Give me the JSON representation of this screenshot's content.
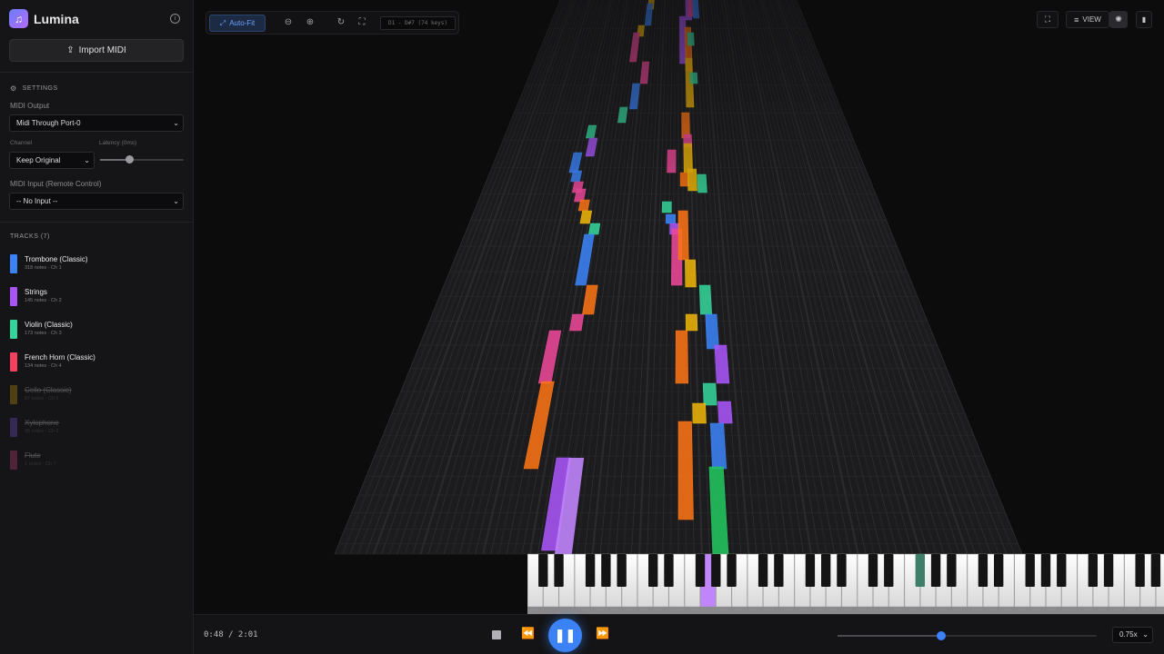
{
  "app": {
    "name": "Lumina",
    "import_label": "Import MIDI"
  },
  "settings": {
    "heading": "SETTINGS",
    "midi_output_label": "MIDI Output",
    "midi_output_value": "Midi Through Port-0",
    "channel_label": "Channel",
    "channel_value": "Keep Original",
    "latency_label": "Latency (0ms)",
    "latency_fraction": 0.35,
    "midi_input_label": "MIDI Input (Remote Control)",
    "midi_input_value": "-- No Input --"
  },
  "tracks": {
    "heading": "TRACKS (7)",
    "items": [
      {
        "name": "Trombone (Classic)",
        "meta": "318 notes · Ch 1",
        "color": "#3b82f6",
        "muted": false
      },
      {
        "name": "Strings",
        "meta": "145 notes · Ch 2",
        "color": "#a855f7",
        "muted": false
      },
      {
        "name": "Violin (Classic)",
        "meta": "173 notes · Ch 3",
        "color": "#34d399",
        "muted": false
      },
      {
        "name": "French Horn (Classic)",
        "meta": "134 notes · Ch 4",
        "color": "#f43f5e",
        "muted": false
      },
      {
        "name": "Cello (Classic)",
        "meta": "87 notes · Ch 5",
        "color": "#eab308",
        "muted": true
      },
      {
        "name": "Xylophone",
        "meta": "95 notes · Ch 6",
        "color": "#8b5cf6",
        "muted": true
      },
      {
        "name": "Flute",
        "meta": "1 notes · Ch 7",
        "color": "#ec4899",
        "muted": true
      }
    ]
  },
  "toolbar": {
    "autofit_label": "Auto-Fit",
    "range_text": "D1 - D#7 (74 keys)",
    "view_label": "VIEW"
  },
  "player": {
    "time": "0:48 / 2:01",
    "progress_fraction": 0.4,
    "speed": "0.75x"
  },
  "colors": {
    "accent": "#3b82f6",
    "note_colors": [
      "#3b82f6",
      "#a855f7",
      "#f97316",
      "#eab308",
      "#ec4899",
      "#34d399",
      "#22c55e"
    ]
  }
}
